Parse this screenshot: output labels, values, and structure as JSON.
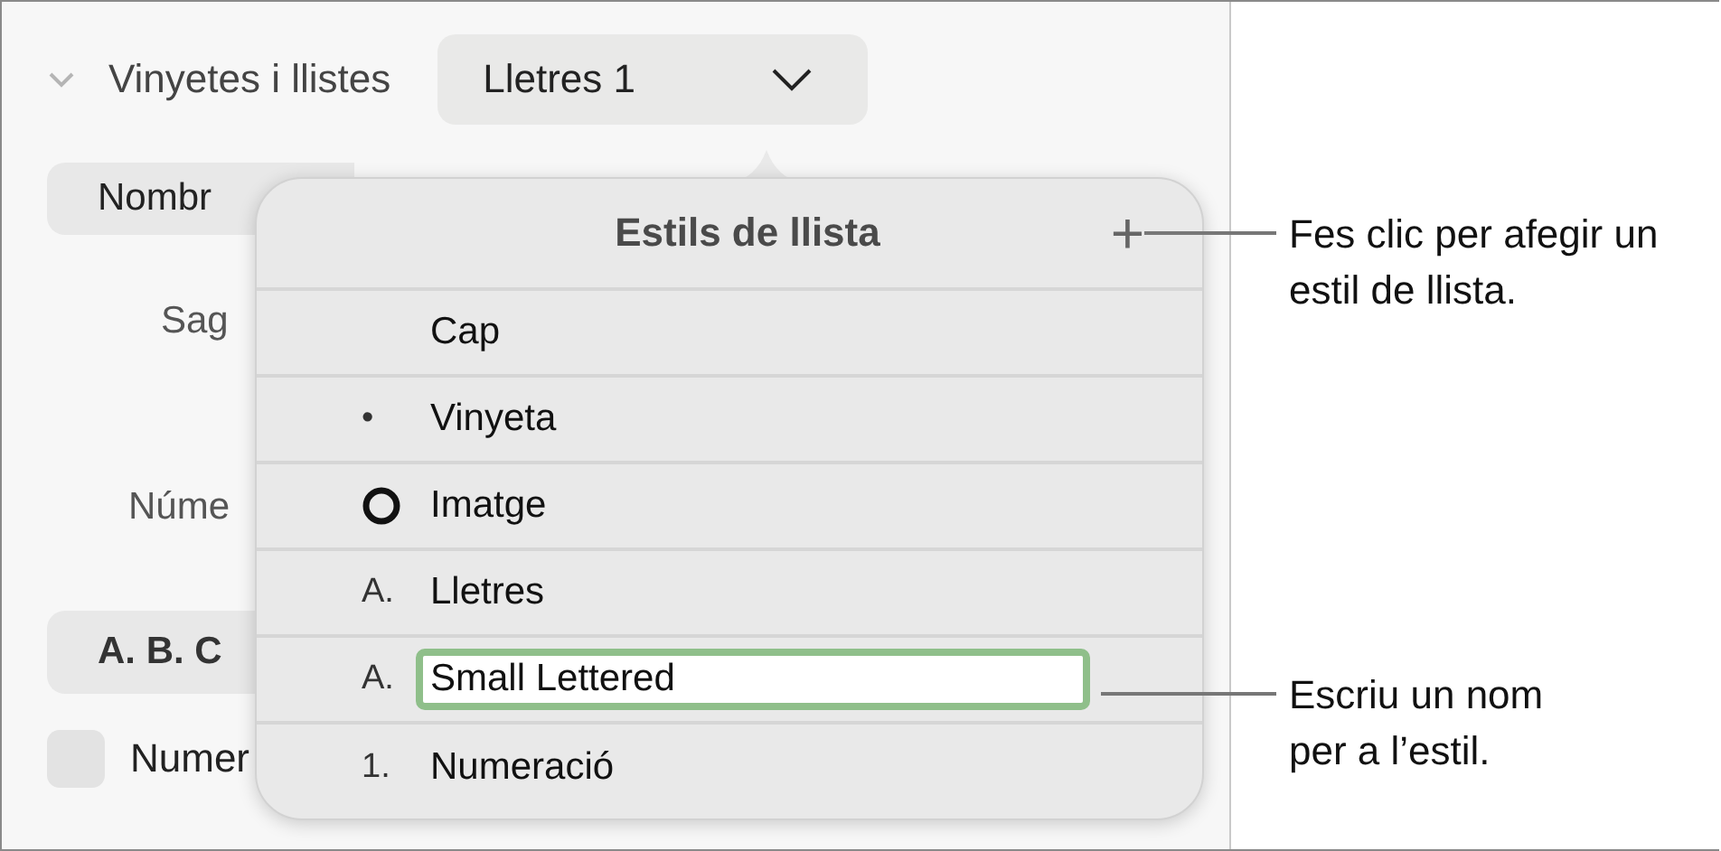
{
  "panel": {
    "section": {
      "title": "Vinyetes i llistes",
      "expanded": true,
      "dropdown": "Lletres 1"
    },
    "rows": [
      {
        "kind": "pill",
        "text": "Nombr"
      },
      {
        "kind": "label",
        "text": "Sag"
      },
      {
        "kind": "label",
        "text": "Núme"
      },
      {
        "kind": "pill",
        "text": "A. B. C"
      },
      {
        "kind": "checkbox",
        "text": "Numer",
        "checked": false
      }
    ]
  },
  "popover": {
    "title": "Estils de llista",
    "add_button": "+",
    "items": [
      {
        "kind": "label",
        "label": "Cap"
      },
      {
        "kind": "label",
        "marker": "•",
        "label": "Vinyeta"
      },
      {
        "kind": "image",
        "label": "Imatge"
      },
      {
        "kind": "label",
        "marker": "A.",
        "label": "Lletres"
      },
      {
        "kind": "field",
        "marker": "A.",
        "label": "Small Lettered"
      },
      {
        "kind": "label",
        "marker": "1.",
        "label": "Numeració"
      }
    ]
  },
  "callouts": [
    {
      "text": "Fes clic per afegir un estil de llista."
    },
    {
      "text": "Escriu un nom per a l’estil."
    }
  ]
}
